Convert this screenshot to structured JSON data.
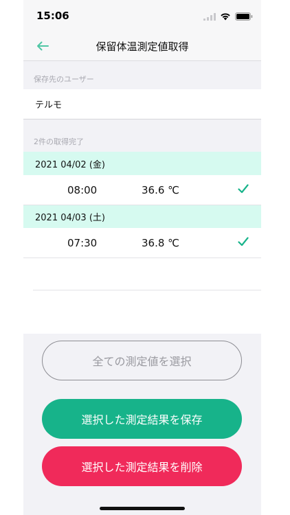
{
  "status_bar": {
    "time": "15:06"
  },
  "nav": {
    "title": "保留体温測定値取得"
  },
  "user_section": {
    "header": "保存先のユーザー",
    "user_name": "テルモ"
  },
  "results_section": {
    "header": "2件の取得完了",
    "entries": [
      {
        "date": "2021 04/02 (金)",
        "time": "08:00",
        "temperature": "36.6 ℃",
        "checked": true
      },
      {
        "date": "2021 04/03 (土)",
        "time": "07:30",
        "temperature": "36.8 ℃",
        "checked": true
      }
    ]
  },
  "buttons": {
    "select_all": "全ての測定値を選択",
    "save": "選択した測定結果を保存",
    "delete": "選択した測定結果を削除"
  },
  "colors": {
    "accent_green": "#17b38a",
    "delete_red": "#f02a5a",
    "date_row_bg": "#d6faf0",
    "nav_back": "#4fc6a4"
  }
}
